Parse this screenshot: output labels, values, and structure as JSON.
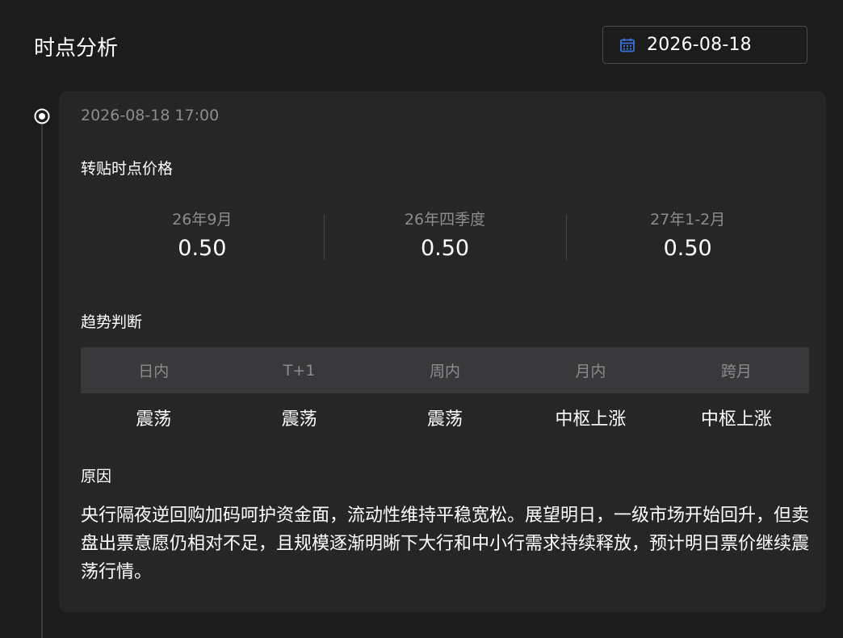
{
  "header": {
    "title": "时点分析",
    "date": "2026-08-18"
  },
  "card": {
    "timestamp": "2026-08-18 17:00",
    "price_section_label": "转贴时点价格",
    "prices": [
      {
        "label": "26年9月",
        "value": "0.50"
      },
      {
        "label": "26年四季度",
        "value": "0.50"
      },
      {
        "label": "27年1-2月",
        "value": "0.50"
      }
    ],
    "trend_section_label": "趋势判断",
    "trend_headers": [
      "日内",
      "T+1",
      "周内",
      "月内",
      "跨月"
    ],
    "trend_values": [
      "震荡",
      "震荡",
      "震荡",
      "中枢上涨",
      "中枢上涨"
    ],
    "reason_label": "原因",
    "reason_text": "央行隔夜逆回购加码呵护资金面，流动性维持平稳宽松。展望明日，一级市场开始回升，但卖盘出票意愿仍相对不足，且规模逐渐明晰下大行和中小行需求持续释放，预计明日票价继续震荡行情。"
  },
  "colors": {
    "accent": "#3b6fd8",
    "background": "#1c1c1d",
    "card": "#262627"
  },
  "icons": {
    "date_picker": "calendar-icon",
    "timeline": "radio-dot-icon"
  }
}
